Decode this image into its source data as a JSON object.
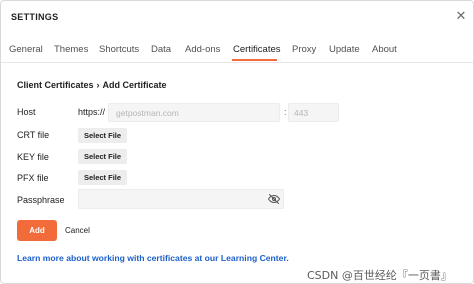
{
  "window": {
    "title": "SETTINGS"
  },
  "tabs": [
    {
      "label": "General"
    },
    {
      "label": "Themes"
    },
    {
      "label": "Shortcuts"
    },
    {
      "label": "Data"
    },
    {
      "label": "Add-ons"
    },
    {
      "label": "Certificates",
      "active": true
    },
    {
      "label": "Proxy"
    },
    {
      "label": "Update"
    },
    {
      "label": "About"
    }
  ],
  "breadcrumb": {
    "parent": "Client Certificates",
    "separator": "›",
    "current": "Add Certificate"
  },
  "form": {
    "host": {
      "label": "Host",
      "scheme": "https://",
      "placeholder": "getpostman.com",
      "port_separator": ":",
      "port_placeholder": "443"
    },
    "crt": {
      "label": "CRT file",
      "button": "Select File"
    },
    "key": {
      "label": "KEY file",
      "button": "Select File"
    },
    "pfx": {
      "label": "PFX file",
      "button": "Select File"
    },
    "passphrase": {
      "label": "Passphrase",
      "value": ""
    }
  },
  "actions": {
    "add_label": "Add",
    "cancel_label": "Cancel"
  },
  "learn_more": "Learn more about working with certificates at our Learning Center.",
  "watermark": "CSDN @百世经纶『一页書』",
  "colors": {
    "accent": "#f26b3a",
    "link": "#1d60c9",
    "input_bg": "#f5f5f5"
  },
  "icons": {
    "close": "close-icon",
    "eye": "eye-off-icon"
  }
}
